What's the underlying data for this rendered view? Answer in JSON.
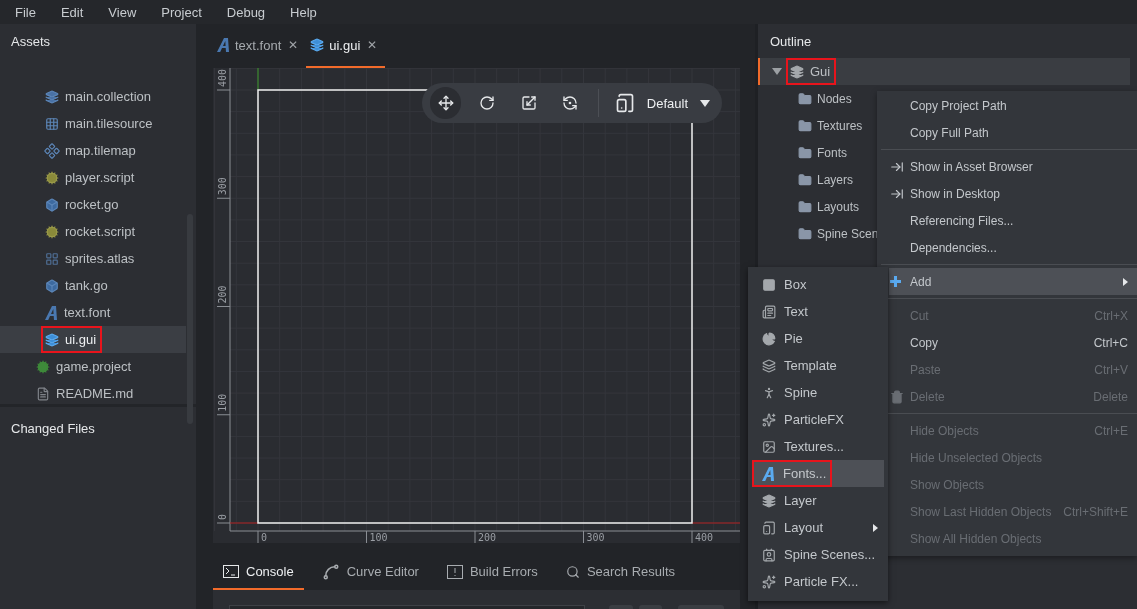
{
  "menu_bar": [
    "File",
    "Edit",
    "View",
    "Project",
    "Debug",
    "Help"
  ],
  "assets": {
    "title": "Assets",
    "items": [
      {
        "kind": "folder",
        "children": [
          {
            "label": "main.collection",
            "kind": "collection",
            "selected": false,
            "annotated": false
          },
          {
            "label": "main.tilesource",
            "kind": "tilesource",
            "selected": false,
            "annotated": false
          },
          {
            "label": "map.tilemap",
            "kind": "tilemap",
            "selected": false,
            "annotated": false
          },
          {
            "label": "player.script",
            "kind": "script",
            "selected": false,
            "annotated": false
          },
          {
            "label": "rocket.go",
            "kind": "go",
            "selected": false,
            "annotated": false
          },
          {
            "label": "rocket.script",
            "kind": "script",
            "selected": false,
            "annotated": false
          },
          {
            "label": "sprites.atlas",
            "kind": "atlas",
            "selected": false,
            "annotated": false
          },
          {
            "label": "tank.go",
            "kind": "go",
            "selected": false,
            "annotated": false
          },
          {
            "label": "text.font",
            "kind": "font",
            "selected": false,
            "annotated": false
          },
          {
            "label": "ui.gui",
            "kind": "gui",
            "selected": true,
            "annotated": true
          }
        ]
      },
      {
        "label": "game.project",
        "kind": "project",
        "selected": false,
        "annotated": false
      },
      {
        "label": "README.md",
        "kind": "markdown",
        "selected": false,
        "annotated": false
      }
    ]
  },
  "changed_files": {
    "title": "Changed Files"
  },
  "editor_tabs": [
    {
      "label": "text.font",
      "kind": "font",
      "selected": false,
      "close": "✕"
    },
    {
      "label": "ui.gui",
      "kind": "gui",
      "selected": true,
      "close": "✕"
    }
  ],
  "canvas": {
    "vertical_ruler": [
      "0",
      "100",
      "200",
      "300",
      "400"
    ],
    "horizontal_ruler": [
      "0",
      "100",
      "200",
      "300",
      "400"
    ],
    "toolbar": {
      "tools": [
        {
          "kind": "move",
          "selected": true
        },
        {
          "kind": "rotate",
          "selected": false
        },
        {
          "kind": "scale",
          "selected": false
        },
        {
          "kind": "visibility",
          "selected": false
        }
      ],
      "layout": "Default"
    }
  },
  "bottom_tabs": [
    {
      "label": "Console",
      "kind": "console",
      "selected": true
    },
    {
      "label": "Curve Editor",
      "kind": "curve",
      "selected": false
    },
    {
      "label": "Build Errors",
      "kind": "errors",
      "selected": false
    },
    {
      "label": "Search Results",
      "kind": "search",
      "selected": false
    }
  ],
  "outline": {
    "title": "Outline",
    "root": {
      "label": "Gui",
      "expanded": true,
      "selected": true,
      "annotated": true,
      "children": [
        {
          "label": "Nodes"
        },
        {
          "label": "Textures"
        },
        {
          "label": "Fonts"
        },
        {
          "label": "Layers"
        },
        {
          "label": "Layouts"
        },
        {
          "label": "Spine Scen"
        }
      ]
    }
  },
  "context_menu": {
    "groups": [
      [
        {
          "label": "Copy Project Path",
          "kind": "plain",
          "disabled": false,
          "selected": false
        },
        {
          "label": "Copy Full Path",
          "kind": "plain",
          "disabled": false,
          "selected": false
        }
      ],
      [
        {
          "label": "Show in Asset Browser",
          "kind": "reveal",
          "disabled": false,
          "selected": false
        },
        {
          "label": "Show in Desktop",
          "kind": "reveal",
          "disabled": false,
          "selected": false
        },
        {
          "label": "Referencing Files...",
          "kind": "plain",
          "disabled": false,
          "selected": false
        },
        {
          "label": "Dependencies...",
          "kind": "plain",
          "disabled": false,
          "selected": false
        }
      ],
      [
        {
          "label": "Add",
          "kind": "add",
          "disabled": false,
          "selected": true,
          "submenu": true
        }
      ],
      [
        {
          "label": "Cut",
          "kind": "plain",
          "disabled": true,
          "selected": false,
          "shortcut": "Ctrl+X"
        },
        {
          "label": "Copy",
          "kind": "plain",
          "disabled": false,
          "selected": false,
          "shortcut": "Ctrl+C"
        },
        {
          "label": "Paste",
          "kind": "plain",
          "disabled": true,
          "selected": false,
          "shortcut": "Ctrl+V"
        },
        {
          "label": "Delete",
          "kind": "delete",
          "disabled": true,
          "selected": false,
          "shortcut": "Delete"
        }
      ],
      [
        {
          "label": "Hide Objects",
          "kind": "plain",
          "disabled": true,
          "selected": false,
          "shortcut": "Ctrl+E"
        },
        {
          "label": "Hide Unselected Objects",
          "kind": "plain",
          "disabled": true,
          "selected": false
        },
        {
          "label": "Show Objects",
          "kind": "plain",
          "disabled": true,
          "selected": false
        },
        {
          "label": "Show Last Hidden Objects",
          "kind": "plain",
          "disabled": true,
          "selected": false,
          "shortcut": "Ctrl+Shift+E"
        },
        {
          "label": "Show All Hidden Objects",
          "kind": "plain",
          "disabled": true,
          "selected": false
        }
      ]
    ]
  },
  "add_submenu": [
    {
      "label": "Box",
      "kind": "box",
      "selected": false,
      "annotated": false
    },
    {
      "label": "Text",
      "kind": "text",
      "selected": false,
      "annotated": false
    },
    {
      "label": "Pie",
      "kind": "pie",
      "selected": false,
      "annotated": false
    },
    {
      "label": "Template",
      "kind": "template",
      "selected": false,
      "annotated": false
    },
    {
      "label": "Spine",
      "kind": "spine",
      "selected": false,
      "annotated": false
    },
    {
      "label": "ParticleFX",
      "kind": "particle",
      "selected": false,
      "annotated": false
    },
    {
      "label": "Textures...",
      "kind": "textures",
      "selected": false,
      "annotated": false
    },
    {
      "label": "Fonts...",
      "kind": "font",
      "selected": true,
      "annotated": true
    },
    {
      "label": "Layer",
      "kind": "layer",
      "selected": false,
      "annotated": false
    },
    {
      "label": "Layout",
      "kind": "layout",
      "selected": false,
      "annotated": false,
      "submenu": true
    },
    {
      "label": "Spine Scenes...",
      "kind": "spinescene",
      "selected": false,
      "annotated": false
    },
    {
      "label": "Particle FX...",
      "kind": "particle",
      "selected": false,
      "annotated": false
    }
  ]
}
